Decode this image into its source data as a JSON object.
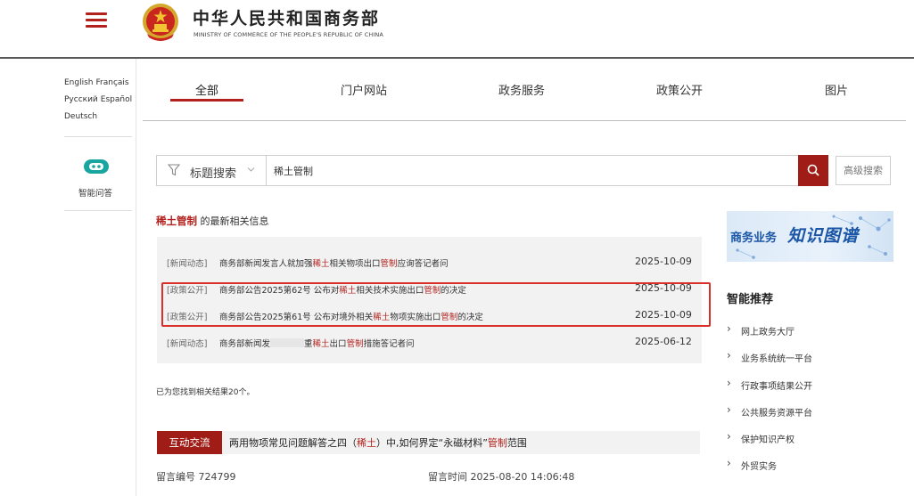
{
  "header": {
    "title_cn": "中华人民共和国商务部",
    "title_en": "MINISTRY OF COMMERCE OF THE PEOPLE'S REPUBLIC OF CHINA",
    "brand_color": "#b3211d"
  },
  "languages": [
    "English",
    "Français",
    "Русский",
    "Español",
    "Deutsch"
  ],
  "assistant_label": "智能问答",
  "tabs": [
    {
      "label": "全部",
      "active": true
    },
    {
      "label": "门户网站"
    },
    {
      "label": "政务服务"
    },
    {
      "label": "政策公开"
    },
    {
      "label": "图片"
    }
  ],
  "search": {
    "type_label": "标题搜索",
    "value": "稀土管制",
    "advanced_label": "高级搜索"
  },
  "results_heading": {
    "keyword": "稀土管制",
    "suffix": " 的最新相关信息"
  },
  "results": [
    {
      "category": "[新闻动态]",
      "parts": [
        "商务部新闻发言人就加强",
        "稀土",
        "相关物项出口",
        "管制",
        "应询答记者问"
      ],
      "date": "2025-10-09"
    },
    {
      "category": "[政策公开]",
      "parts": [
        "商务部公告2025第62号 公布对",
        "稀土",
        "相关技术实施出口",
        "管制",
        "的决定"
      ],
      "date": "2025-10-09"
    },
    {
      "category": "[政策公开]",
      "parts": [
        "商务部公告2025第61号 公布对境外相关",
        "稀土",
        "物项实施出口",
        "管制",
        "的决定"
      ],
      "date": "2025-10-09"
    },
    {
      "category": "[新闻动态]",
      "parts": [
        "商务部新闻发",
        "重",
        "稀土",
        "出口",
        "管制",
        "措施答记者问"
      ],
      "date": "2025-06-12"
    }
  ],
  "result_count_text": "已为您找到相关结果20个。",
  "interaction": {
    "badge": "互动交流",
    "title_parts": [
      "两用物项常见问题解答之四（",
      "稀土",
      "）中,如何界定“永磁材料”",
      "管制",
      "范围"
    ],
    "message_id": "留言编号 724799",
    "message_time": "留言时间 2025-08-20 14:06:48"
  },
  "banner": {
    "text1": "商务业务",
    "text2": "知识图谱"
  },
  "recommend": {
    "title": "智能推荐",
    "items": [
      "网上政务大厅",
      "业务系统统一平台",
      "行政事项结果公开",
      "公共服务资源平台",
      "保护知识产权",
      "外贸实务"
    ]
  }
}
